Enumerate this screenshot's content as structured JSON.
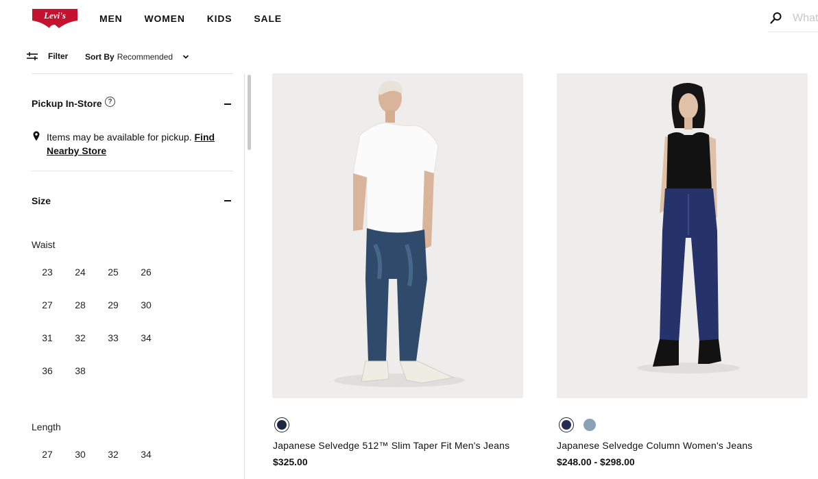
{
  "header": {
    "logo_text": "Levi's",
    "logo_color": "#c41230",
    "nav": [
      "MEN",
      "WOMEN",
      "KIDS",
      "SALE"
    ],
    "search_placeholder": "What"
  },
  "toolbar": {
    "filter_label": "Filter",
    "sort_key": "Sort By",
    "sort_value": "Recommended"
  },
  "sidebar": {
    "pickup": {
      "title": "Pickup In-Store",
      "help_icon": "?",
      "text": "Items may be available for pickup. ",
      "link": "Find Nearby Store"
    },
    "size": {
      "title": "Size",
      "waist_label": "Waist",
      "waist": [
        "23",
        "24",
        "25",
        "26",
        "27",
        "28",
        "29",
        "30",
        "31",
        "32",
        "33",
        "34",
        "36",
        "38"
      ],
      "length_label": "Length",
      "length": [
        "27",
        "30",
        "32",
        "34"
      ]
    }
  },
  "products": [
    {
      "name": "Japanese Selvedge 512™ Slim Taper Fit Men's Jeans",
      "price": "$325.00",
      "swatches": [
        "#1c2740"
      ]
    },
    {
      "name": "Japanese Selvedge Column Women's Jeans",
      "price": "$248.00 - $298.00",
      "swatches": [
        "#252b55",
        "#8aa1b8"
      ]
    }
  ]
}
